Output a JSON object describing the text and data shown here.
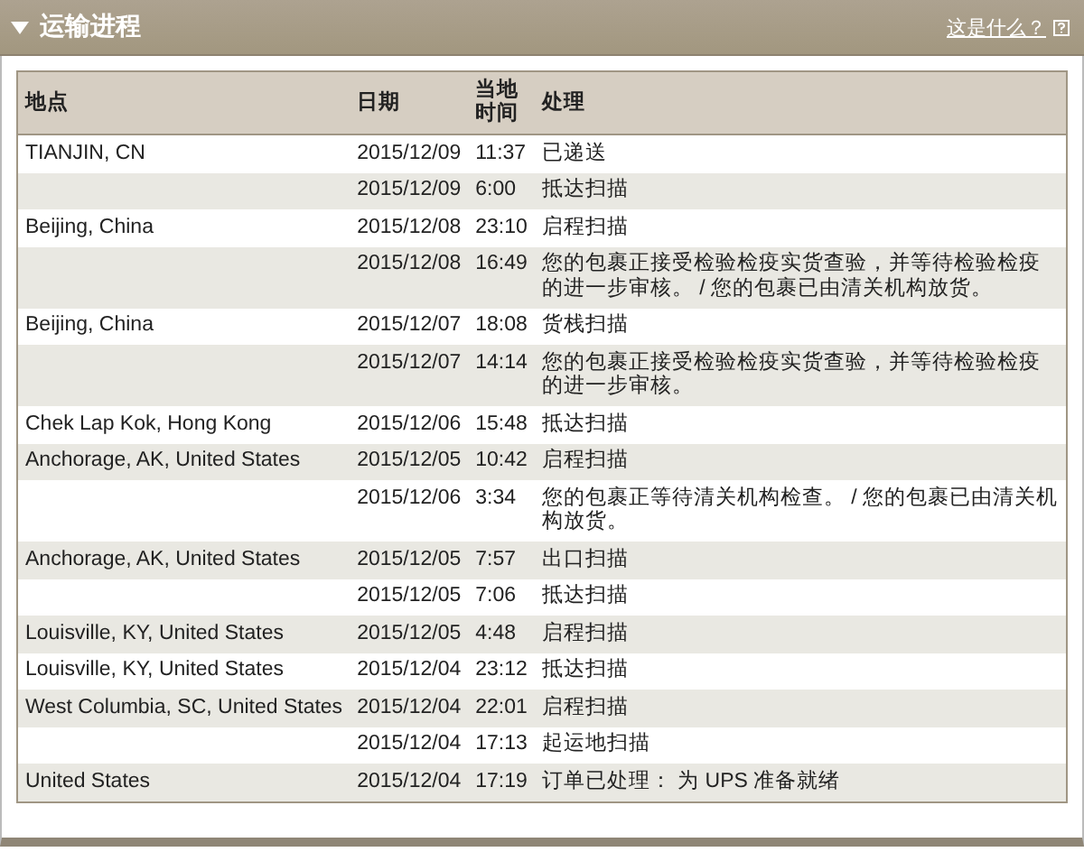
{
  "panel": {
    "title": "运输进程",
    "help_link": "这是什么？"
  },
  "table": {
    "columns": [
      "地点",
      "日期",
      "当地时间",
      "处理"
    ],
    "rows": [
      {
        "location": "TIANJIN, CN",
        "date": "2015/12/09",
        "time": "11:37",
        "activity": "已递送"
      },
      {
        "location": "",
        "date": "2015/12/09",
        "time": "6:00",
        "activity": "抵达扫描"
      },
      {
        "location": "Beijing, China",
        "date": "2015/12/08",
        "time": "23:10",
        "activity": "启程扫描"
      },
      {
        "location": "",
        "date": "2015/12/08",
        "time": "16:49",
        "activity": "您的包裹正接受检验检疫实货查验，并等待检验检疫的进一步审核。 / 您的包裹已由清关机构放货。"
      },
      {
        "location": "Beijing, China",
        "date": "2015/12/07",
        "time": "18:08",
        "activity": "货栈扫描"
      },
      {
        "location": "",
        "date": "2015/12/07",
        "time": "14:14",
        "activity": "您的包裹正接受检验检疫实货查验，并等待检验检疫的进一步审核。"
      },
      {
        "location": "Chek Lap Kok, Hong Kong",
        "date": "2015/12/06",
        "time": "15:48",
        "activity": "抵达扫描"
      },
      {
        "location": "Anchorage, AK, United States",
        "date": "2015/12/05",
        "time": "10:42",
        "activity": "启程扫描"
      },
      {
        "location": "",
        "date": "2015/12/06",
        "time": "3:34",
        "activity": "您的包裹正等待清关机构检查。 / 您的包裹已由清关机构放货。"
      },
      {
        "location": "Anchorage, AK, United States",
        "date": "2015/12/05",
        "time": "7:57",
        "activity": "出口扫描"
      },
      {
        "location": "",
        "date": "2015/12/05",
        "time": "7:06",
        "activity": "抵达扫描"
      },
      {
        "location": "Louisville, KY, United States",
        "date": "2015/12/05",
        "time": "4:48",
        "activity": "启程扫描"
      },
      {
        "location": "Louisville, KY, United States",
        "date": "2015/12/04",
        "time": "23:12",
        "activity": "抵达扫描"
      },
      {
        "location": "West Columbia, SC, United States",
        "date": "2015/12/04",
        "time": "22:01",
        "activity": "启程扫描"
      },
      {
        "location": "",
        "date": "2015/12/04",
        "time": "17:13",
        "activity": "起运地扫描"
      },
      {
        "location": "United States",
        "date": "2015/12/04",
        "time": "17:19",
        "activity": "订单已处理： 为 UPS 准备就绪"
      }
    ]
  }
}
